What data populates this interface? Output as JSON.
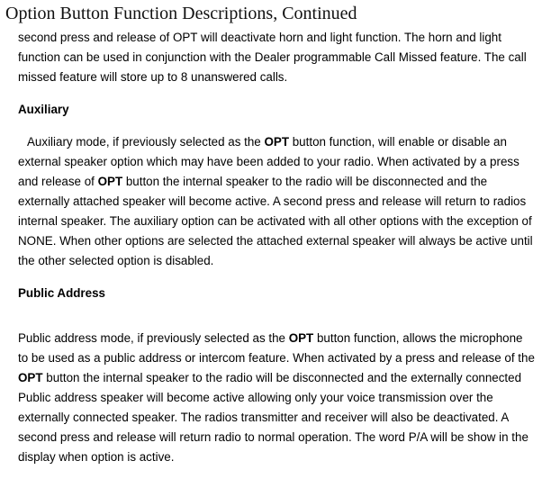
{
  "title": "Option Button Function Descriptions, Continued",
  "content": {
    "intro": "second press and release of OPT will deactivate horn and light function. The horn and light function can be used in conjunction with the Dealer programmable Call Missed feature. The call missed feature will store up to 8 unanswered calls.",
    "aux_heading": "Auxiliary",
    "aux_pre": "Auxiliary mode, if previously selected as the ",
    "aux_opt1": "OPT",
    "aux_mid1": " button function, will enable or disable an external speaker option which may have been added to your radio. When activated by a press and release of ",
    "aux_opt2": "OPT",
    "aux_post": " button the internal speaker to the radio will be disconnected and the externally attached speaker will become active. A second press and release will return to radios internal speaker. The auxiliary option can be activated with all other options with the exception of NONE. When other options are selected the attached external speaker will always be active until the other selected option is disabled.",
    "pa_heading": "Public Address",
    "pa_pre": "Public address mode, if previously selected as the ",
    "pa_opt1": "OPT",
    "pa_mid1": " button function, allows the microphone to be used as a public address or intercom feature. When activated by a press and release of the ",
    "pa_opt2": "OPT",
    "pa_post": " button the internal speaker to the radio will be disconnected and the externally connected Public address speaker will become active allowing only your voice transmission over the externally connected speaker. The radios transmitter and receiver will also be deactivated. A second press and release will return radio to normal operation. The word P/A will be show in the display when option is active."
  }
}
